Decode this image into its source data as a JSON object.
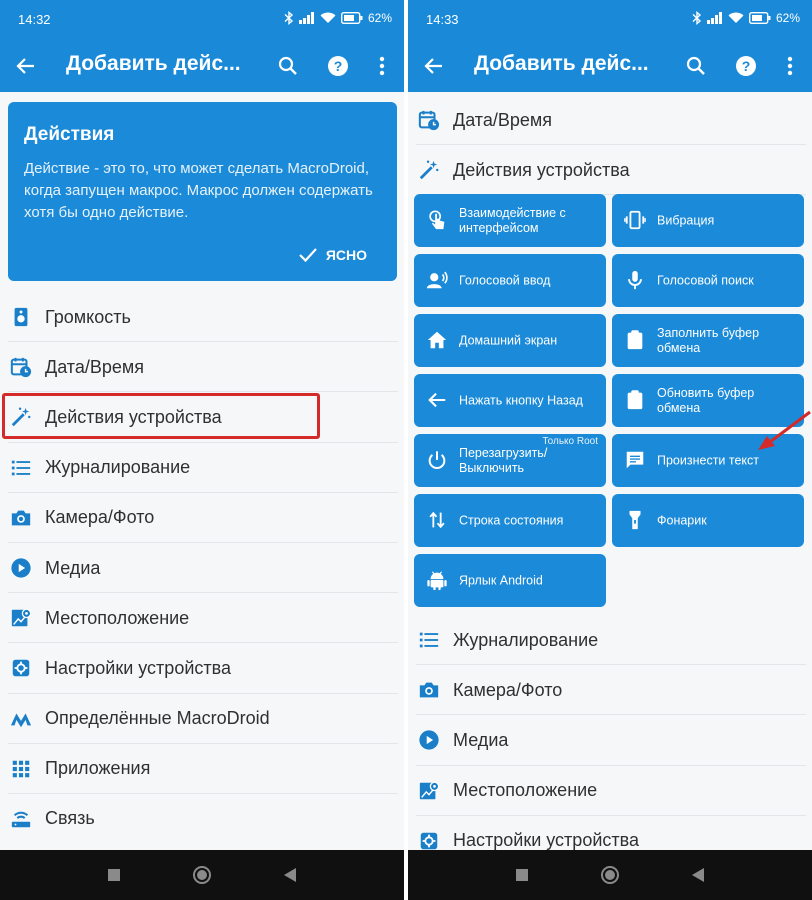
{
  "left": {
    "status": {
      "time": "14:32",
      "battery": "62%"
    },
    "appbar": {
      "title": "Добавить дейс..."
    },
    "info_card": {
      "title": "Действия",
      "text": "Действие - это то, что может сделать MacroDroid, когда запущен макрос. Макрос должен содержать хотя бы одно действие.",
      "ok_label": "ЯСНО"
    },
    "categories": [
      {
        "label": "Громкость",
        "icon": "speaker-icon"
      },
      {
        "label": "Дата/Время",
        "icon": "calendar-clock-icon"
      },
      {
        "label": "Действия устройства",
        "icon": "magic-wand-icon"
      },
      {
        "label": "Журналирование",
        "icon": "list-icon"
      },
      {
        "label": "Камера/Фото",
        "icon": "camera-icon"
      },
      {
        "label": "Медиа",
        "icon": "play-circle-icon"
      },
      {
        "label": "Местоположение",
        "icon": "map-pin-icon"
      },
      {
        "label": "Настройки устройства",
        "icon": "settings-icon"
      },
      {
        "label": "Определённые MacroDroid",
        "icon": "macrodroid-logo-icon"
      },
      {
        "label": "Приложения",
        "icon": "apps-grid-icon"
      },
      {
        "label": "Связь",
        "icon": "router-icon"
      }
    ]
  },
  "right": {
    "status": {
      "time": "14:33",
      "battery": "62%"
    },
    "appbar": {
      "title": "Добавить дейс..."
    },
    "top_categories": [
      {
        "label": "Дата/Время",
        "icon": "calendar-clock-icon"
      },
      {
        "label": "Действия устройства",
        "icon": "magic-wand-icon"
      }
    ],
    "actions": [
      {
        "label": "Взаимодействие с интерфейсом",
        "icon": "touch-icon"
      },
      {
        "label": "Вибрация",
        "icon": "vibrate-icon"
      },
      {
        "label": "Голосовой ввод",
        "icon": "voice-input-icon"
      },
      {
        "label": "Голосовой поиск",
        "icon": "microphone-icon"
      },
      {
        "label": "Домашний экран",
        "icon": "home-icon"
      },
      {
        "label": "Заполнить буфер обмена",
        "icon": "clipboard-icon"
      },
      {
        "label": "Нажать кнопку Назад",
        "icon": "back-arrow-icon"
      },
      {
        "label": "Обновить буфер обмена",
        "icon": "clipboard-upload-icon"
      },
      {
        "label": "Перезагрузить/ Выключить",
        "icon": "power-icon",
        "tag": "Только Root"
      },
      {
        "label": "Произнести текст",
        "icon": "speech-bubble-icon"
      },
      {
        "label": "Строка состояния",
        "icon": "swap-vertical-icon"
      },
      {
        "label": "Фонарик",
        "icon": "flashlight-icon"
      },
      {
        "label": "Ярлык Android",
        "icon": "android-icon"
      }
    ],
    "bottom_categories": [
      {
        "label": "Журналирование",
        "icon": "list-icon"
      },
      {
        "label": "Камера/Фото",
        "icon": "camera-icon"
      },
      {
        "label": "Медиа",
        "icon": "play-circle-icon"
      },
      {
        "label": "Местоположение",
        "icon": "map-pin-icon"
      },
      {
        "label": "Настройки устройства",
        "icon": "settings-icon"
      }
    ]
  },
  "colors": {
    "primary": "#1a8ad8",
    "tile": "#1b8ad8",
    "icon": "#1a7fc8",
    "highlight": "#d42a2a",
    "navbar": "#101010"
  }
}
